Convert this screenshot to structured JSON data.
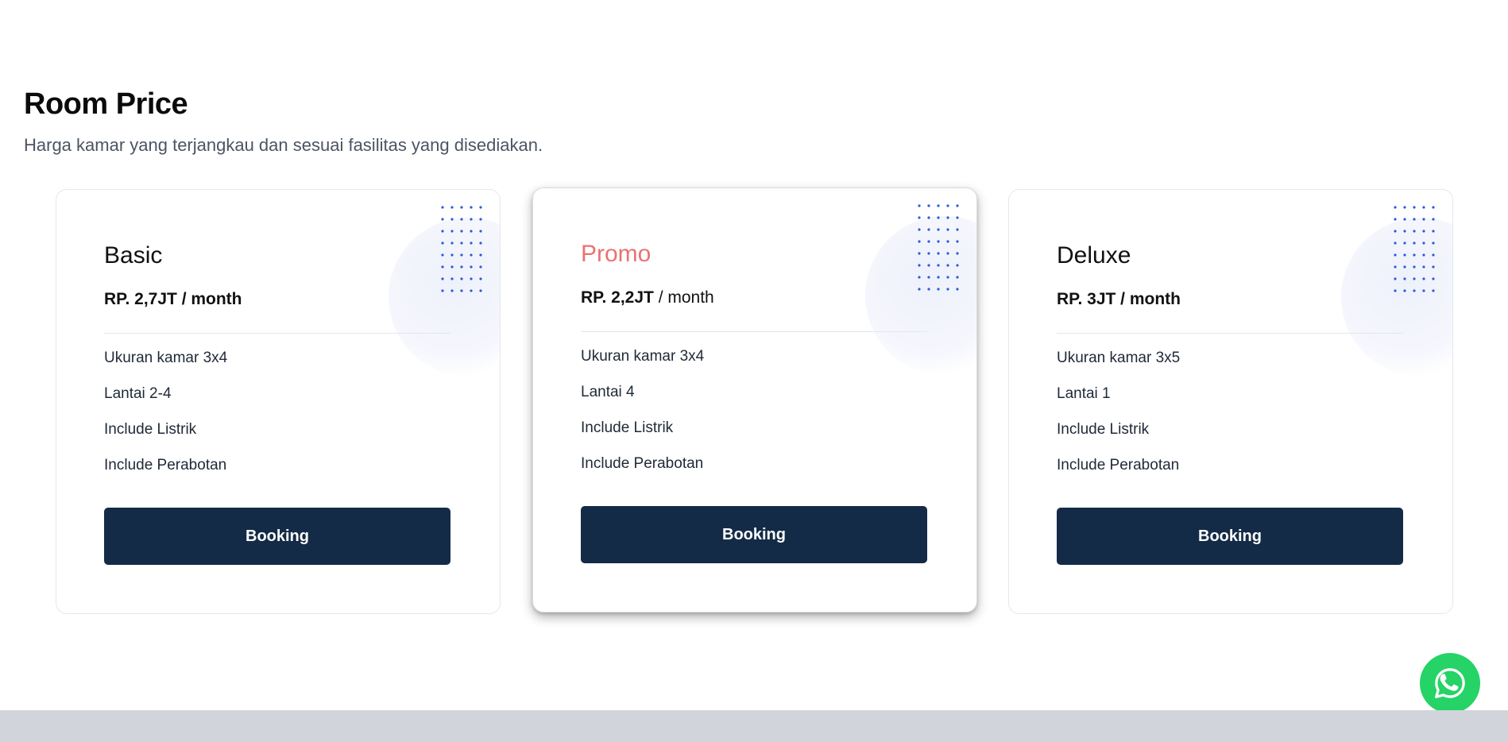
{
  "section": {
    "title": "Room Price",
    "subtitle": "Harga kamar yang terjangkau dan sesuai fasilitas yang disediakan."
  },
  "plans": [
    {
      "name": "Basic",
      "price": "RP. 2,7JT",
      "period": "/ month",
      "features": [
        "Ukuran kamar 3x4",
        "Lantai 2-4",
        "Include Listrik",
        "Include Perabotan"
      ],
      "button_label": "Booking"
    },
    {
      "name": "Promo",
      "price": "RP. 2,2JT",
      "period": "/ month",
      "features": [
        "Ukuran kamar 3x4",
        "Lantai 4",
        "Include Listrik",
        "Include Perabotan"
      ],
      "button_label": "Booking"
    },
    {
      "name": "Deluxe",
      "price": "RP. 3JT",
      "period": "/ month",
      "features": [
        "Ukuran kamar 3x5",
        "Lantai 1",
        "Include Listrik",
        "Include Perabotan"
      ],
      "button_label": "Booking"
    }
  ],
  "colors": {
    "accent_promo": "#ea7272",
    "button_bg": "#132b47",
    "dots": "#2f5bd8",
    "whatsapp": "#25d366"
  },
  "icons": {
    "floating_action": "whatsapp-icon",
    "card_decoration": "dot-grid-icon"
  }
}
